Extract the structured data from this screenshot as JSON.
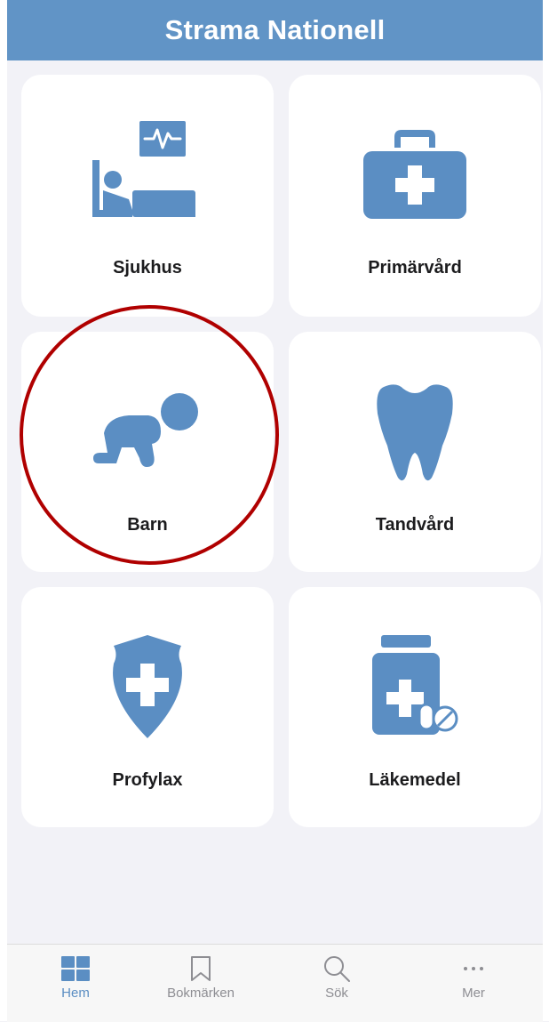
{
  "app": {
    "title": "Strama Nationell"
  },
  "colors": {
    "accent": "#6194c6",
    "icon": "#5b8ec3",
    "highlight_circle": "#b00000"
  },
  "tiles": [
    {
      "label": "Sjukhus",
      "icon": "hospital-bed-icon"
    },
    {
      "label": "Primärvård",
      "icon": "medical-bag-icon"
    },
    {
      "label": "Barn",
      "icon": "crawling-baby-icon"
    },
    {
      "label": "Tandvård",
      "icon": "tooth-icon"
    },
    {
      "label": "Profylax",
      "icon": "shield-cross-icon"
    },
    {
      "label": "Läkemedel",
      "icon": "medicine-bottle-icon"
    }
  ],
  "tabbar": {
    "items": [
      {
        "label": "Hem",
        "icon": "grid-icon",
        "active": true
      },
      {
        "label": "Bokmärken",
        "icon": "bookmark-icon",
        "active": false
      },
      {
        "label": "Sök",
        "icon": "search-icon",
        "active": false
      },
      {
        "label": "Mer",
        "icon": "more-dots-icon",
        "active": false
      }
    ]
  }
}
